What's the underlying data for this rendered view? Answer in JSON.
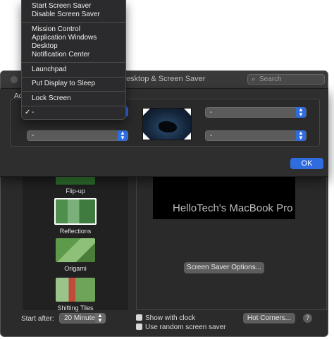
{
  "window": {
    "title": "Desktop & Screen Saver"
  },
  "search": {
    "placeholder": "Search"
  },
  "sheet": {
    "label": "Ac",
    "corners": {
      "top_left": "-",
      "top_right": "-",
      "bottom_left": "-",
      "bottom_right": "-"
    },
    "ok_label": "OK"
  },
  "menu": {
    "items": [
      {
        "label": "Start Screen Saver"
      },
      {
        "label": "Disable Screen Saver"
      },
      {
        "label": "Mission Control"
      },
      {
        "label": "Application Windows"
      },
      {
        "label": "Desktop"
      },
      {
        "label": "Notification Center"
      },
      {
        "label": "Launchpad"
      },
      {
        "label": "Put Display to Sleep"
      },
      {
        "label": "Lock Screen"
      },
      {
        "label": "-"
      }
    ],
    "checkmark": "✓"
  },
  "screensavers": [
    {
      "label": "Flip-up"
    },
    {
      "label": "Reflections"
    },
    {
      "label": "Origami"
    },
    {
      "label": "Shifting Tiles"
    }
  ],
  "preview": {
    "text": "HelloTech's MacBook Pro",
    "options_label": "Screen Saver Options..."
  },
  "footer": {
    "start_after_label": "Start after:",
    "start_after_value": "20 Minutes",
    "show_clock_label": "Show with clock",
    "random_label": "Use random screen saver",
    "hot_corners_label": "Hot Corners...",
    "help_label": "?"
  },
  "colors": {
    "accent": "#2f6ce0",
    "window_bg": "#2b2b2b"
  }
}
